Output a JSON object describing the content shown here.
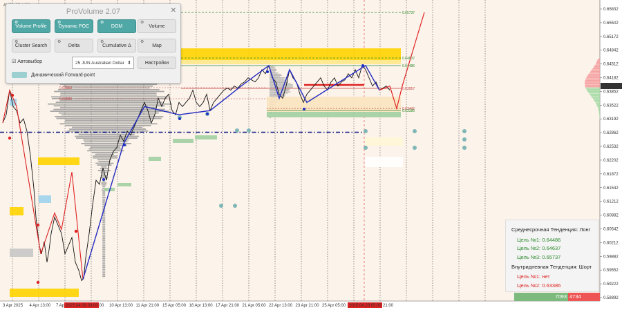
{
  "symbol_label": "AUDUSD,M30",
  "panel": {
    "title": "ProVolume 2.07",
    "close": "✕",
    "buttons": [
      {
        "label": "Volume Profile",
        "active": true
      },
      {
        "label": "Dynamic POC",
        "active": true
      },
      {
        "label": "DOM",
        "active": true
      },
      {
        "label": "Volume",
        "active": false
      },
      {
        "label": "Cluster Search",
        "active": false
      },
      {
        "label": "Delta",
        "active": false
      },
      {
        "label": "Cumulative Δ",
        "active": false
      },
      {
        "label": "Map",
        "active": false
      }
    ],
    "auto_select": "Автовыбор",
    "instrument": "25 JUN Australian Dollar",
    "settings": "Настройки",
    "forward": "Динамический Forward-point"
  },
  "price_ticks": [
    "0.65832",
    "0.65502",
    "0.65172",
    "0.64842",
    "0.64512",
    "0.64182",
    "0.63852",
    "0.63522",
    "0.63192",
    "0.62862",
    "0.62532",
    "0.62202",
    "0.61872",
    "0.61542",
    "0.61212",
    "0.60882",
    "0.60542",
    "0.60212",
    "0.59882",
    "0.59552",
    "0.59222",
    "0.58892"
  ],
  "current_price": "0.63984",
  "time_ticks": [
    "3 Apr 2025",
    "4 Apr 13:00",
    "7 Apr",
    "8 Apr 21:00",
    "10 Apr 13:00",
    "11 Apr 21:00",
    "15 Apr 05:00",
    "16 Apr 13:00",
    "17 Apr 21:00",
    "21 Apr 05:00",
    "22 Apr 13:00",
    "23 Apr 21:00",
    "25 Apr 05:00",
    "28 Apr 13:00",
    "Apr 21:00"
  ],
  "time_highlights": [
    "2025.04.09 03:00",
    "2025.04.29 05:00"
  ],
  "levels": {
    "target3": "0.65737",
    "target2": "0.64637",
    "target1": "0.64486",
    "mid": "0.63957",
    "low1": "0.63442",
    "low2": "0.63386",
    "left1": "0.63950",
    "left2": "0.63680"
  },
  "trend": {
    "mid_title": "Среднесрочная Тенденция: Лонг",
    "mid_targets": [
      "Цель №1: 0.64486",
      "Цель №2: 0.64637",
      "Цель №3: 0.65737"
    ],
    "intra_title": "Внутридневная Тенденция: Шорт",
    "intra_targets": [
      "Цель №1: нет",
      "Цель №2: 0.63386"
    ]
  },
  "volume_bar": {
    "buy": "7093",
    "sell": "4734",
    "buy_color": "#7dba7d",
    "sell_color": "#e55555"
  },
  "chart_data": {
    "type": "line",
    "title": "AUDUSD,M30",
    "ylim": [
      0.5875,
      0.66
    ],
    "price_path": [
      [
        0,
        0.631
      ],
      [
        5,
        0.633
      ],
      [
        10,
        0.639
      ],
      [
        15,
        0.635
      ],
      [
        20,
        0.634
      ],
      [
        25,
        0.631
      ],
      [
        30,
        0.632
      ],
      [
        35,
        0.629
      ],
      [
        40,
        0.623
      ],
      [
        45,
        0.615
      ],
      [
        48,
        0.608
      ],
      [
        50,
        0.605
      ],
      [
        53,
        0.601
      ],
      [
        56,
        0.599
      ],
      [
        60,
        0.602
      ],
      [
        64,
        0.597
      ],
      [
        67,
        0.6
      ],
      [
        70,
        0.604
      ],
      [
        75,
        0.608
      ],
      [
        80,
        0.606
      ],
      [
        85,
        0.604
      ],
      [
        90,
        0.599
      ],
      [
        95,
        0.601
      ],
      [
        100,
        0.603
      ],
      [
        105,
        0.597
      ],
      [
        110,
        0.595
      ],
      [
        114,
        0.5925
      ],
      [
        117,
        0.593
      ],
      [
        120,
        0.598
      ],
      [
        125,
        0.604
      ],
      [
        130,
        0.611
      ],
      [
        135,
        0.617
      ],
      [
        140,
        0.616
      ],
      [
        145,
        0.62
      ],
      [
        150,
        0.617
      ],
      [
        155,
        0.622
      ],
      [
        160,
        0.624
      ],
      [
        165,
        0.625
      ],
      [
        170,
        0.628
      ],
      [
        175,
        0.6265
      ],
      [
        180,
        0.629
      ],
      [
        185,
        0.628
      ],
      [
        190,
        0.63
      ],
      [
        195,
        0.632
      ],
      [
        200,
        0.634
      ],
      [
        205,
        0.636
      ],
      [
        210,
        0.634
      ],
      [
        215,
        0.631
      ],
      [
        220,
        0.633
      ],
      [
        225,
        0.637
      ],
      [
        230,
        0.635
      ],
      [
        235,
        0.637
      ],
      [
        240,
        0.638
      ],
      [
        245,
        0.634
      ],
      [
        250,
        0.633
      ],
      [
        255,
        0.636
      ],
      [
        260,
        0.635
      ],
      [
        265,
        0.636
      ],
      [
        270,
        0.637
      ],
      [
        275,
        0.639
      ],
      [
        280,
        0.636
      ],
      [
        285,
        0.635
      ],
      [
        290,
        0.636
      ],
      [
        295,
        0.638
      ],
      [
        300,
        0.634
      ],
      [
        305,
        0.636
      ],
      [
        310,
        0.637
      ],
      [
        315,
        0.638
      ],
      [
        320,
        0.639
      ],
      [
        325,
        0.6395
      ],
      [
        330,
        0.639
      ],
      [
        335,
        0.64
      ],
      [
        340,
        0.6395
      ],
      [
        345,
        0.6405
      ],
      [
        350,
        0.641
      ],
      [
        355,
        0.642
      ],
      [
        360,
        0.6415
      ],
      [
        365,
        0.641
      ],
      [
        370,
        0.642
      ],
      [
        375,
        0.644
      ],
      [
        380,
        0.643
      ],
      [
        385,
        0.645
      ],
      [
        390,
        0.642
      ],
      [
        395,
        0.641
      ],
      [
        400,
        0.638
      ],
      [
        405,
        0.637
      ],
      [
        410,
        0.64
      ],
      [
        415,
        0.644
      ],
      [
        420,
        0.642
      ],
      [
        425,
        0.641
      ],
      [
        430,
        0.638
      ],
      [
        435,
        0.636
      ],
      [
        440,
        0.638
      ],
      [
        445,
        0.639
      ],
      [
        450,
        0.64
      ],
      [
        455,
        0.641
      ],
      [
        460,
        0.642
      ],
      [
        465,
        0.64
      ],
      [
        470,
        0.639
      ],
      [
        475,
        0.641
      ],
      [
        480,
        0.642
      ],
      [
        485,
        0.64
      ],
      [
        490,
        0.641
      ],
      [
        495,
        0.6415
      ],
      [
        500,
        0.643
      ],
      [
        505,
        0.642
      ],
      [
        510,
        0.644
      ],
      [
        515,
        0.642
      ],
      [
        520,
        0.645
      ],
      [
        525,
        0.644
      ],
      [
        530,
        0.642
      ],
      [
        535,
        0.64
      ],
      [
        540,
        0.641
      ],
      [
        545,
        0.639
      ],
      [
        550,
        0.6395
      ],
      [
        555,
        0.64
      ],
      [
        560,
        0.639
      ]
    ],
    "zigzag": [
      [
        0,
        0.631
      ],
      [
        10,
        0.639
      ],
      [
        20,
        0.635
      ],
      [
        50,
        0.604
      ],
      [
        55,
        0.599
      ],
      [
        75,
        0.609
      ],
      [
        85,
        0.605
      ],
      [
        100,
        0.619
      ],
      [
        116,
        0.5928
      ],
      [
        175,
        0.626
      ],
      [
        205,
        0.635
      ],
      [
        255,
        0.633
      ],
      [
        300,
        0.634
      ],
      [
        345,
        0.64
      ],
      [
        385,
        0.645
      ],
      [
        400,
        0.637
      ],
      [
        415,
        0.644
      ],
      [
        440,
        0.636
      ],
      [
        525,
        0.645
      ],
      [
        545,
        0.639
      ]
    ],
    "projection": [
      [
        545,
        0.639
      ],
      [
        560,
        0.64
      ],
      [
        570,
        0.6345
      ],
      [
        578,
        0.64
      ],
      [
        610,
        0.658
      ]
    ],
    "dashed_level": 0.6287
  }
}
